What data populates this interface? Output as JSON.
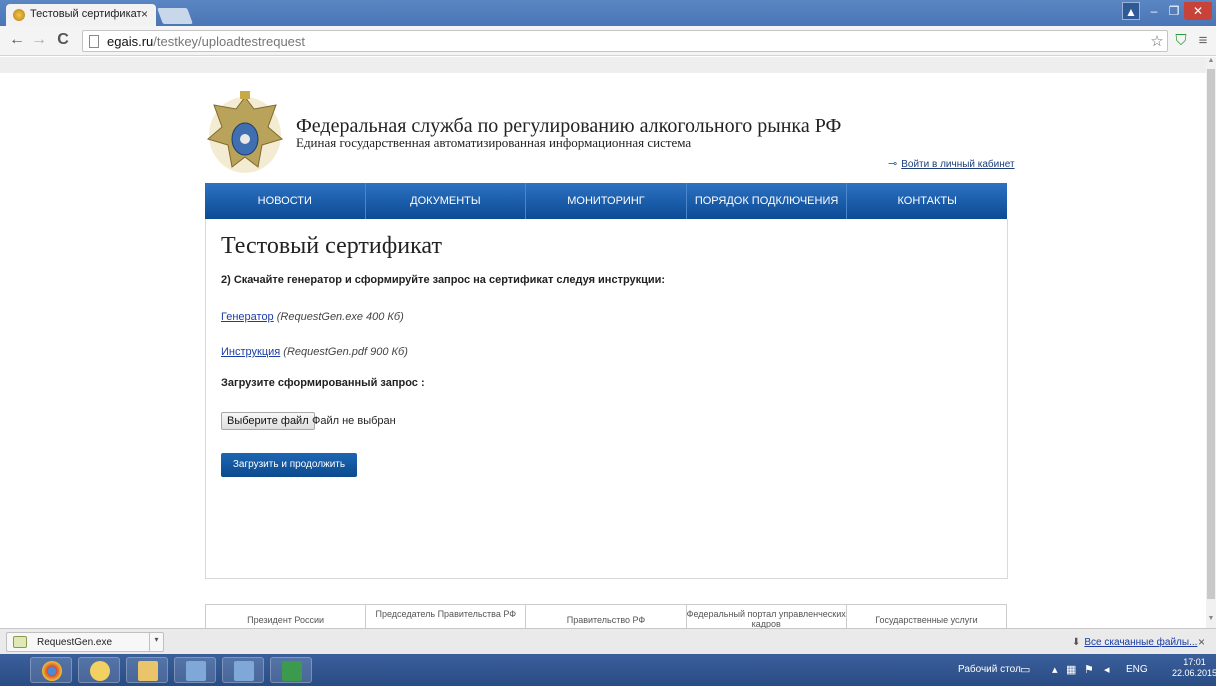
{
  "browser": {
    "tab_title": "Тестовый сертификат",
    "tab_close": "×",
    "url_domain": "egais.ru",
    "url_path": "/testkey/uploadtestrequest"
  },
  "site": {
    "title": "Федеральная служба по регулированию алкогольного рынка РФ",
    "subtitle": "Единая государственная автоматизированная информационная система",
    "login_link": "Войти в личный кабинет",
    "nav": [
      "НОВОСТИ",
      "ДОКУМЕНТЫ",
      "МОНИТОРИНГ",
      "ПОРЯДОК ПОДКЛЮЧЕНИЯ",
      "КОНТАКТЫ"
    ]
  },
  "content": {
    "page_title": "Тестовый сертификат",
    "step_text": "2) Скачайте генератор и сформируйте запрос на сертификат следуя инструкции:",
    "generator_link": "Генератор",
    "generator_meta": "(RequestGen.exe 400 Кб)",
    "instruction_link": "Инструкция",
    "instruction_meta": "(RequestGen.pdf 900 Кб)",
    "upload_label": "Загрузите сформированный запрос :",
    "file_button": "Выберите файл",
    "file_status": "Файл не выбран",
    "submit_button": "Загрузить и продолжить"
  },
  "footer": {
    "items": [
      "Президент России",
      "Председатель Правительства РФ",
      "Правительство РФ",
      "Федеральный портал управленческих кадров",
      "Государственные услуги"
    ]
  },
  "downloads": {
    "file_name": "RequestGen.exe",
    "all_downloads": "Все скачанные файлы...",
    "close": "×"
  },
  "taskbar": {
    "desktop_label": "Рабочий стол",
    "language": "ENG",
    "time": "17:01",
    "date": "22.06.2015"
  },
  "colors": {
    "nav_blue": "#0c4a94",
    "link_blue": "#1c3da6",
    "tabstrip": "#4a76b6"
  }
}
